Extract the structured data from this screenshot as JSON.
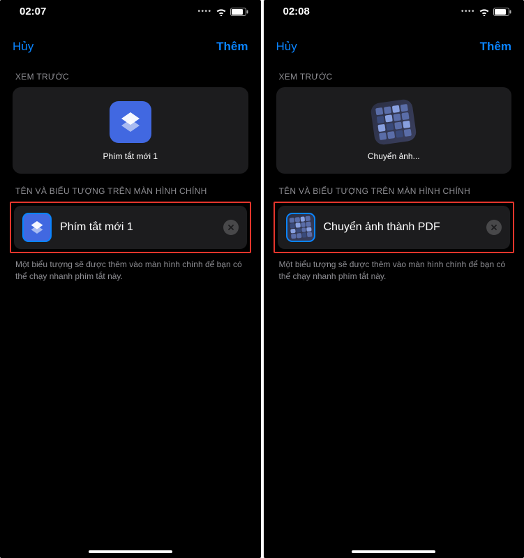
{
  "left": {
    "time": "02:07",
    "nav_cancel": "Hủy",
    "nav_add": "Thêm",
    "preview_header": "XEM TRƯỚC",
    "preview_label": "Phím tắt mới 1",
    "section2": "TÊN VÀ BIỂU TƯỢNG TRÊN MÀN HÌNH CHÍNH",
    "input_value": "Phím tắt mới 1",
    "hint": "Một biểu tượng sẽ được thêm vào màn hình chính để bạn có thể chạy nhanh phím tắt này."
  },
  "right": {
    "time": "02:08",
    "nav_cancel": "Hủy",
    "nav_add": "Thêm",
    "preview_header": "XEM TRƯỚC",
    "preview_label": "Chuyển ảnh...",
    "section2": "TÊN VÀ BIỂU TƯỢNG TRÊN MÀN HÌNH CHÍNH",
    "input_value": "Chuyển ảnh thành PDF",
    "hint": "Một biểu tượng sẽ được thêm vào màn hình chính để bạn có thể chạy nhanh phím tắt này."
  }
}
